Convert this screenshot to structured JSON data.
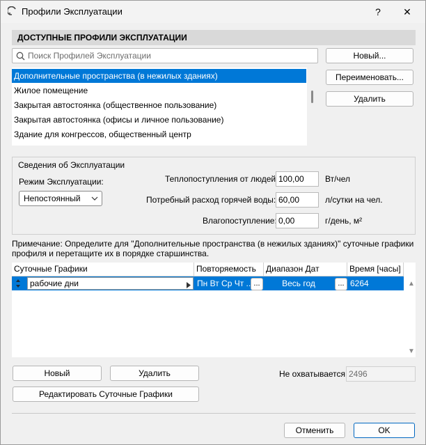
{
  "window": {
    "title": "Профили Эксплуатации",
    "help": "?",
    "close": "✕"
  },
  "profiles": {
    "header": "ДОСТУПНЫЕ ПРОФИЛИ ЭКСПЛУАТАЦИИ",
    "search_placeholder": "Поиск Профилей Эксплуатации",
    "items": [
      "Дополнительные пространства (в нежилых зданиях)",
      "Жилое помещение",
      "Закрытая автостоянка (общественное пользование)",
      "Закрытая автостоянка (офисы и личное пользование)",
      "Здание для конгрессов, общественный центр"
    ],
    "selected_index": 0,
    "new_button": "Новый...",
    "rename_button": "Переименовать...",
    "delete_button": "Удалить"
  },
  "operation": {
    "title": "Сведения об Эксплуатации",
    "mode_label": "Режим Эксплуатации:",
    "mode_value": "Непостоянный",
    "heat_label": "Теплопоступления от людей:",
    "heat_value": "100,00",
    "heat_unit": "Вт/чел",
    "water_label": "Потребный расход горячей воды:",
    "water_value": "60,00",
    "water_unit": "л/сутки на чел.",
    "moisture_label": "Влагопоступление:",
    "moisture_value": "0,00",
    "moisture_unit": "г/день, м²"
  },
  "note": "Примечание: Определите для \"Дополнительные пространства (в нежилых зданиях)\" суточные графики профиля и перетащите их в порядке старшинства.",
  "schedules": {
    "columns": [
      "Суточные Графики",
      "Повторяемость",
      "Диапазон Дат",
      "Время [часы]"
    ],
    "rows": [
      {
        "name": "рабочие дни",
        "repeat": "Пн Вт Ср Чт ...",
        "range": "Весь год",
        "hours": "6264"
      }
    ],
    "ellipsis": "...",
    "new_button": "Новый",
    "delete_button": "Удалить",
    "edit_button": "Редактировать Суточные Графики",
    "uncovered_label": "Не охватывается:",
    "uncovered_value": "2496"
  },
  "footer": {
    "cancel": "Отменить",
    "ok": "OK"
  },
  "colors": {
    "selection": "#0078d7",
    "accent_border": "#0067c0"
  }
}
